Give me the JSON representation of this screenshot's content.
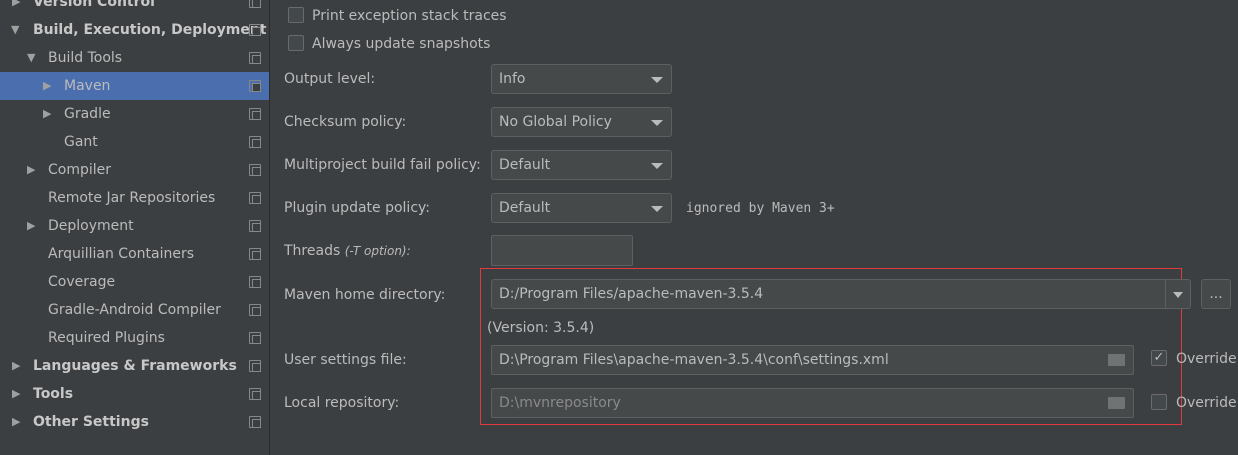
{
  "sidebar": {
    "items": [
      {
        "label": "Version Control",
        "expanded": false
      },
      {
        "label": "Build, Execution, Deployment",
        "expanded": true
      },
      {
        "label": "Build Tools",
        "expanded": true
      },
      {
        "label": "Maven",
        "selected": true
      },
      {
        "label": "Gradle"
      },
      {
        "label": "Gant"
      },
      {
        "label": "Compiler"
      },
      {
        "label": "Remote Jar Repositories"
      },
      {
        "label": "Deployment"
      },
      {
        "label": "Arquillian Containers"
      },
      {
        "label": "Coverage"
      },
      {
        "label": "Gradle-Android Compiler"
      },
      {
        "label": "Required Plugins"
      },
      {
        "label": "Languages & Frameworks"
      },
      {
        "label": "Tools"
      },
      {
        "label": "Other Settings"
      }
    ]
  },
  "main": {
    "print_exception": {
      "label": "Print exception stack traces",
      "checked": false
    },
    "always_update": {
      "label": "Always update snapshots",
      "checked": false
    },
    "output_level": {
      "label": "Output level:",
      "value": "Info"
    },
    "checksum_policy": {
      "label": "Checksum policy:",
      "value": "No Global Policy"
    },
    "multiproject_policy": {
      "label": "Multiproject build fail policy:",
      "value": "Default"
    },
    "plugin_update_policy": {
      "label": "Plugin update policy:",
      "value": "Default",
      "hint": "ignored by Maven 3+"
    },
    "threads": {
      "label": "Threads",
      "hint": "(-T option):",
      "value": ""
    },
    "maven_home": {
      "label": "Maven home directory:",
      "value": "D:/Program Files/apache-maven-3.5.4",
      "browse": "...",
      "version": "(Version: 3.5.4)"
    },
    "user_settings": {
      "label": "User settings file:",
      "value": "D:\\Program Files\\apache-maven-3.5.4\\conf\\settings.xml",
      "override_label": "Override",
      "override_checked": true
    },
    "local_repo": {
      "label": "Local repository:",
      "value": "D:\\mvnrepository",
      "override_label": "Override",
      "override_checked": false
    }
  },
  "colors": {
    "selection": "#4b6eaf",
    "highlight_box": "#e0393e"
  }
}
